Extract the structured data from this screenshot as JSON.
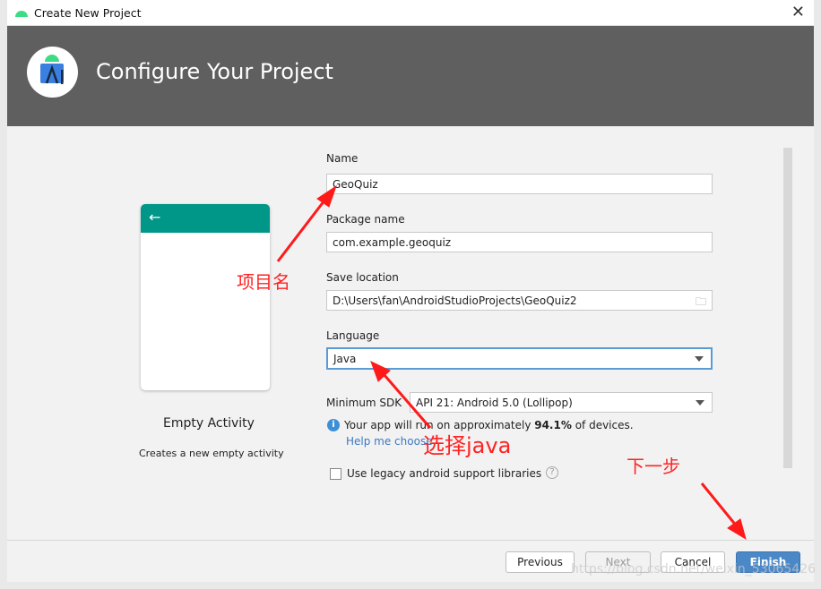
{
  "window": {
    "title": "Create New Project"
  },
  "header": {
    "title": "Configure Your Project"
  },
  "template": {
    "name": "Empty Activity",
    "description": "Creates a new empty activity"
  },
  "form": {
    "name_label": "Name",
    "name_value": "GeoQuiz",
    "package_label": "Package name",
    "package_value": "com.example.geoquiz",
    "location_label": "Save location",
    "location_value": "D:\\Users\\fan\\AndroidStudioProjects\\GeoQuiz2",
    "language_label": "Language",
    "language_value": "Java",
    "minsdk_label": "Minimum SDK",
    "minsdk_value": "API 21: Android 5.0 (Lollipop)",
    "info_prefix": "Your app will run on approximately ",
    "info_percent": "94.1%",
    "info_suffix": " of devices.",
    "help_link": "Help me choose",
    "legacy_label": "Use legacy android support libraries",
    "legacy_checked": false
  },
  "footer": {
    "previous": "Previous",
    "next": "Next",
    "cancel": "Cancel",
    "finish": "Finish"
  },
  "annotations": {
    "name_note": "项目名",
    "language_note": "选择java",
    "finish_note": "下一步"
  },
  "watermark": "https://blog.csdn.net/weixin_53065426",
  "colors": {
    "header": "#5f5f5f",
    "teal": "#009688",
    "finish": "#4a88c7",
    "annotation": "#ff2222"
  }
}
